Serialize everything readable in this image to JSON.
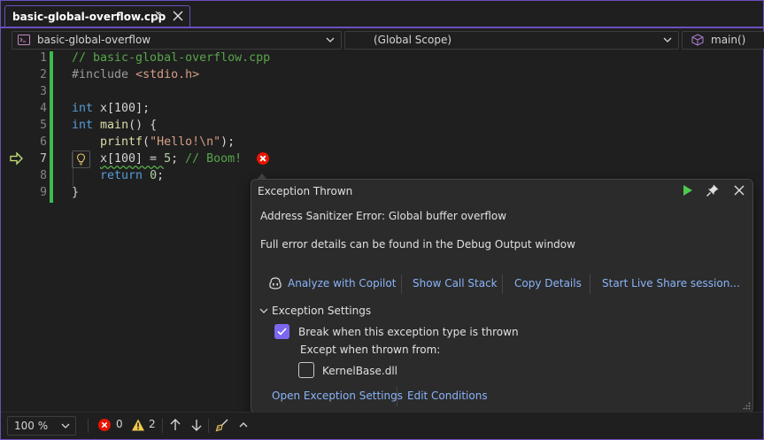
{
  "tab": {
    "title": "basic-global-overflow.cpp"
  },
  "navbar": {
    "project": "basic-global-overflow",
    "scope": "(Global Scope)",
    "member": "main()"
  },
  "editor": {
    "lines": [
      {
        "num": "1"
      },
      {
        "num": "2"
      },
      {
        "num": "3"
      },
      {
        "num": "4"
      },
      {
        "num": "5"
      },
      {
        "num": "6"
      },
      {
        "num": "7"
      },
      {
        "num": "8"
      },
      {
        "num": "9"
      }
    ],
    "code": {
      "l1": "// basic-global-overflow.cpp",
      "l2_a": "#include ",
      "l2_b": "<stdio.h>",
      "l4_kw": "int",
      "l4_rest": " x[100];",
      "l5_kw": "int",
      "l5_fn": "main",
      "l5_rest": "() {",
      "l6_fn": "printf",
      "l6_a": "(",
      "l6_str": "\"Hello!\\n\"",
      "l6_b": ");",
      "l7_a": "x[100] = ",
      "l7_num": "5",
      "l7_b": "; ",
      "l7_cmt": "// Boom!",
      "l8_kw": "return",
      "l8_num": "0",
      "l8_b": ";",
      "l9": "}"
    }
  },
  "exception": {
    "title": "Exception Thrown",
    "message": "Address Sanitizer Error: Global buffer overflow",
    "details": "Full error details can be found in the Debug Output window",
    "actions": {
      "copilot": "Analyze with Copilot",
      "call_stack": "Show Call Stack",
      "copy": "Copy Details",
      "live_share": "Start Live Share session..."
    },
    "settings": {
      "header": "Exception Settings",
      "break_label": "Break when this exception type is thrown",
      "break_checked": true,
      "except_label": "Except when thrown from:",
      "module_label": "KernelBase.dll",
      "module_checked": false
    },
    "footer": {
      "open_settings": "Open Exception Settings",
      "edit_conditions": "Edit Conditions"
    }
  },
  "statusbar": {
    "zoom": "100 %",
    "errors": "0",
    "warnings": "2"
  },
  "colors": {
    "accent": "#6b4fbf",
    "error": "#e51400",
    "warning": "#f2c94c",
    "link": "#8ab4f8",
    "change": "#3fb950",
    "play": "#4ec94e"
  }
}
